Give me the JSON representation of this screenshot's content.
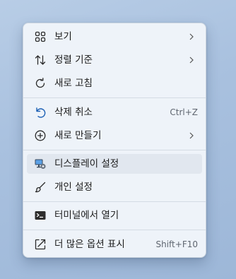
{
  "menu": {
    "items": [
      {
        "label": "보기",
        "icon": "grid-view-icon"
      },
      {
        "label": "정렬 기준",
        "icon": "sort-arrows-icon"
      },
      {
        "label": "새로 고침",
        "icon": "refresh-icon"
      },
      {
        "label": "삭제 취소",
        "shortcut": "Ctrl+Z",
        "icon": "undo-icon"
      },
      {
        "label": "새로 만들기",
        "icon": "add-circle-icon"
      },
      {
        "label": "디스플레이 설정",
        "icon": "display-settings-icon"
      },
      {
        "label": "개인 설정",
        "icon": "paintbrush-icon"
      },
      {
        "label": "터미널에서 열기",
        "icon": "terminal-icon"
      },
      {
        "label": "더 많은 옵션 표시",
        "shortcut": "Shift+F10",
        "icon": "expand-icon"
      }
    ]
  },
  "colors": {
    "accent": "#0a64c8",
    "menu_background": "#eef3f9",
    "hover_background": "#e1e7ef"
  }
}
